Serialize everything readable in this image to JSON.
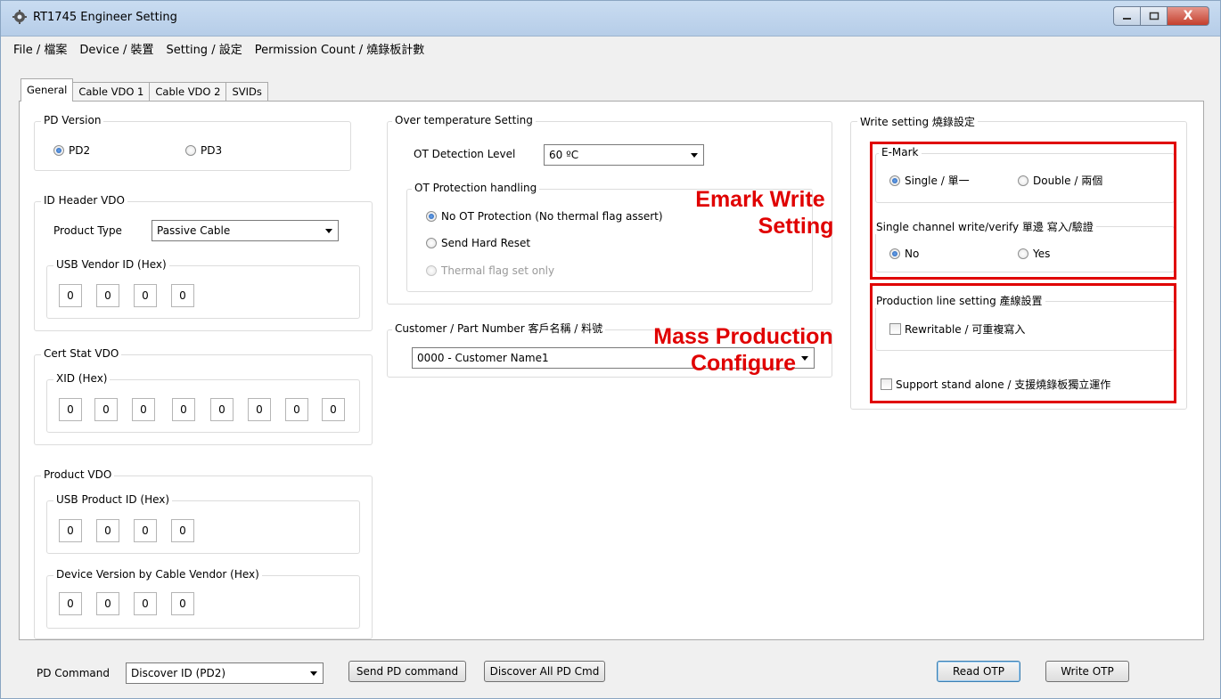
{
  "window": {
    "title": "RT1745 Engineer Setting",
    "close_label": "X"
  },
  "menu": [
    "File / 檔案",
    "Device / 裝置",
    "Setting / 設定",
    "Permission Count / 燒錄板計數"
  ],
  "tabs": [
    "General",
    "Cable VDO 1",
    "Cable VDO 2",
    "SVIDs"
  ],
  "pd_version": {
    "label": "PD Version",
    "options": [
      "PD2",
      "PD3"
    ],
    "selected": "PD2"
  },
  "id_header": {
    "label": "ID Header VDO",
    "product_type_label": "Product Type",
    "product_type_value": "Passive Cable",
    "usb_vendor_label": "USB Vendor ID (Hex)",
    "usb_vendor_values": [
      "0",
      "0",
      "0",
      "0"
    ]
  },
  "cert_stat": {
    "label": "Cert Stat VDO",
    "xid_label": "XID (Hex)",
    "xid_values": [
      "0",
      "0",
      "0",
      "0",
      "0",
      "0",
      "0",
      "0"
    ]
  },
  "product_vdo": {
    "label": "Product VDO",
    "usb_product_label": "USB Product ID (Hex)",
    "usb_product_values": [
      "0",
      "0",
      "0",
      "0"
    ],
    "device_version_label": "Device Version by Cable Vendor (Hex)",
    "device_version_values": [
      "0",
      "0",
      "0",
      "0"
    ]
  },
  "over_temp": {
    "label": "Over temperature Setting",
    "detection_label": "OT Detection Level",
    "detection_value": "60 ºC",
    "handling_label": "OT Protection handling",
    "options": [
      "No OT Protection (No thermal flag assert)",
      "Send Hard Reset",
      "Thermal flag set only"
    ],
    "selected": "No OT Protection (No thermal flag assert)"
  },
  "customer": {
    "label": "Customer / Part Number  客戶名稱 / 料號",
    "value": "0000 - Customer Name1"
  },
  "write_setting": {
    "label": "Write setting 燒錄設定",
    "emark_label": "E-Mark",
    "emark_options": [
      "Single / 單一",
      "Double / 兩個"
    ],
    "emark_selected": "Single / 單一",
    "single_channel_label": "Single channel write/verify 單邊 寫入/驗證",
    "single_channel_options": [
      "No",
      "Yes"
    ],
    "single_channel_selected": "No",
    "production_label": "Production line setting  產線設置",
    "rewritable_label": "Rewritable / 可重複寫入",
    "standalone_label": "Support stand alone / 支援燒錄板獨立運作"
  },
  "annotations": {
    "emark_write_line1": "Emark Write",
    "emark_write_line2": "Setting",
    "mass_production_line1": "Mass Production",
    "mass_production_line2": "Configure"
  },
  "bottom": {
    "pd_command_label": "PD Command",
    "pd_command_value": "Discover ID (PD2)",
    "send_pd_button": "Send PD command",
    "discover_all_button": "Discover All PD Cmd",
    "read_otp_button": "Read OTP",
    "write_otp_button": "Write OTP"
  },
  "colors": {
    "annotation_red": "#e00000",
    "titlebar": "#c9dcf1"
  }
}
